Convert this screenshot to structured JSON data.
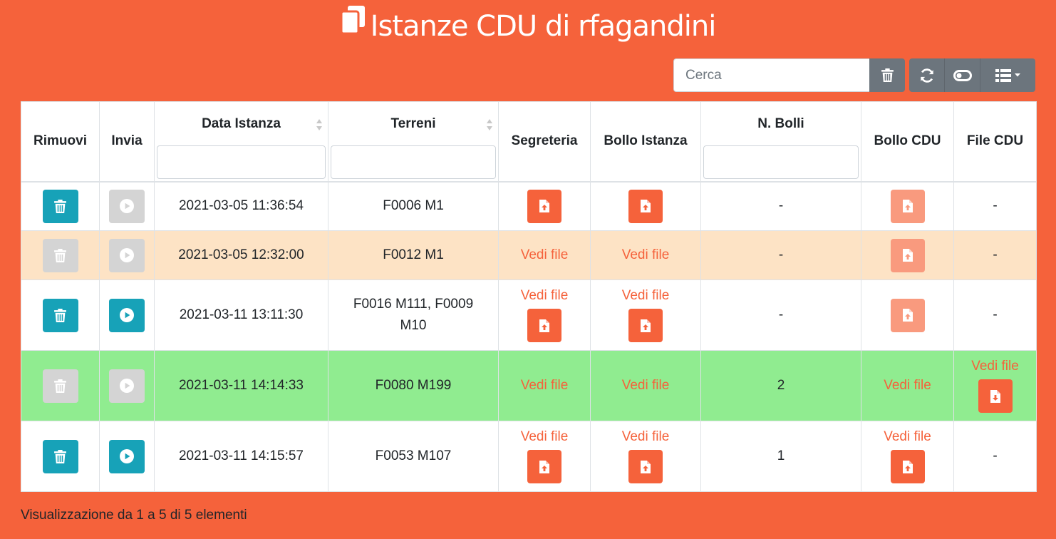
{
  "header": {
    "title": "Istanze CDU di rfagandini"
  },
  "toolbar": {
    "search_placeholder": "Cerca"
  },
  "table": {
    "headers": {
      "rimuovi": "Rimuovi",
      "invia": "Invia",
      "data_istanza": "Data Istanza",
      "terreni": "Terreni",
      "segreteria": "Segreteria",
      "bollo_istanza": "Bollo Istanza",
      "n_bolli": "N. Bolli",
      "bollo_cdu": "Bollo CDU",
      "file_cdu": "File CDU"
    },
    "rows": [
      {
        "data": "2021-03-05 11:36:54",
        "terreni": "F0006 M1",
        "n_bolli": "-",
        "file_cdu": "-",
        "status": "normal"
      },
      {
        "data": "2021-03-05 12:32:00",
        "terreni": "F0012 M1",
        "segreteria": "Vedi file",
        "bollo_istanza": "Vedi file",
        "n_bolli": "-",
        "file_cdu": "-",
        "status": "warning"
      },
      {
        "data": "2021-03-11 13:11:30",
        "terreni": "F0016 M111, F0009 M10",
        "segreteria": "Vedi file",
        "bollo_istanza": "Vedi file",
        "n_bolli": "-",
        "file_cdu": "-",
        "status": "normal"
      },
      {
        "data": "2021-03-11 14:14:33",
        "terreni": "F0080 M199",
        "segreteria": "Vedi file",
        "bollo_istanza": "Vedi file",
        "n_bolli": "2",
        "bollo_cdu": "Vedi file",
        "file_cdu": "Vedi file",
        "status": "success"
      },
      {
        "data": "2021-03-11 14:15:57",
        "terreni": "F0053 M107",
        "segreteria": "Vedi file",
        "bollo_istanza": "Vedi file",
        "n_bolli": "1",
        "bollo_cdu": "Vedi file",
        "file_cdu": "-",
        "status": "normal"
      }
    ]
  },
  "footer": {
    "info": "Visualizzazione da 1 a 5 di 5 elementi"
  },
  "colors": {
    "background": "#f5623b",
    "teal": "#17a2b8",
    "disabled": "#d4d4d4",
    "warning_row": "#fde3c5",
    "success_row": "#90ec90",
    "toolbar_button": "#6c757d"
  }
}
